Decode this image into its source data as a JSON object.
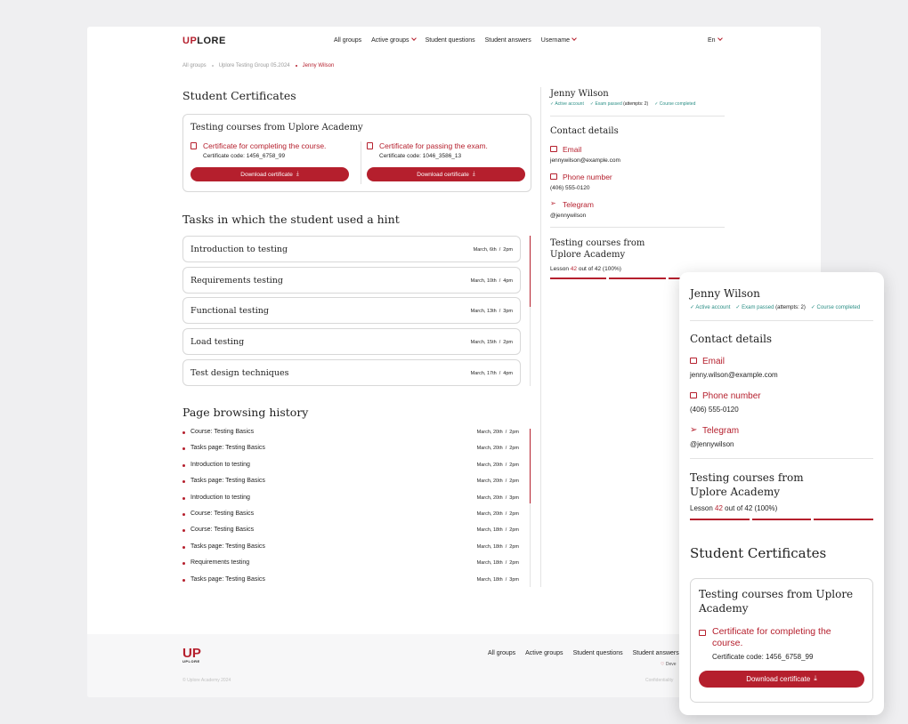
{
  "header": {
    "logo": "UPLORE",
    "nav": [
      "All groups",
      "Active groups",
      "Student questions",
      "Student answers",
      "Username"
    ],
    "lang": "En"
  },
  "breadcrumb": [
    "All groups",
    "Uplore Testing Group 05.2024",
    "Jenny Wilson"
  ],
  "certificates": {
    "title": "Student Certificates",
    "course": "Testing courses from Uplore Academy",
    "items": [
      {
        "label": "Certificate for completing the course.",
        "code": "Certificate code: 1456_6758_99",
        "button": "Download certificate"
      },
      {
        "label": "Certificate for passing the exam.",
        "code": "Certificate code: 1046_3586_13",
        "button": "Download certificate"
      }
    ]
  },
  "tasks": {
    "title": "Tasks in which the student used a hint",
    "items": [
      {
        "name": "Introduction to testing",
        "date": "March, 6th",
        "time": "2pm"
      },
      {
        "name": "Requirements testing",
        "date": "March, 10th",
        "time": "4pm"
      },
      {
        "name": "Functional testing",
        "date": "March, 13th",
        "time": "3pm"
      },
      {
        "name": "Load testing",
        "date": "March, 15th",
        "time": "2pm"
      },
      {
        "name": "Test design techniques",
        "date": "March, 17th",
        "time": "4pm"
      }
    ]
  },
  "history": {
    "title": "Page browsing history",
    "items": [
      {
        "name": "Course: Testing Basics",
        "date": "March, 20th",
        "time": "2pm"
      },
      {
        "name": "Tasks page: Testing Basics",
        "date": "March, 20th",
        "time": "2pm"
      },
      {
        "name": "Introduction to testing",
        "date": "March, 20th",
        "time": "2pm"
      },
      {
        "name": "Tasks page: Testing Basics",
        "date": "March, 20th",
        "time": "2pm"
      },
      {
        "name": "Introduction to testing",
        "date": "March, 20th",
        "time": "3pm"
      },
      {
        "name": "Course: Testing Basics",
        "date": "March, 20th",
        "time": "2pm"
      },
      {
        "name": "Course: Testing Basics",
        "date": "March, 18th",
        "time": "2pm"
      },
      {
        "name": "Tasks page: Testing Basics",
        "date": "March, 18th",
        "time": "2pm"
      },
      {
        "name": "Requirements testing",
        "date": "March, 18th",
        "time": "2pm"
      },
      {
        "name": "Tasks page: Testing Basics",
        "date": "March, 18th",
        "time": "3pm"
      }
    ]
  },
  "student": {
    "name": "Jenny Wilson",
    "badges": [
      "Active account",
      "Exam passed",
      "(attempts: 2)",
      "Course completed"
    ],
    "contact_title": "Contact details",
    "email_label": "Email",
    "email": "jennywilson@example.com",
    "mobile_email": "jenny.wilson@example.com",
    "phone_label": "Phone number",
    "phone": "(406) 555-0120",
    "telegram_label": "Telegram",
    "telegram": "@jennywilson",
    "course_title": "Testing courses from Uplore Academy",
    "course_title_l1": "Testing courses from",
    "course_title_l2": "Uplore Academy",
    "lesson_prefix": "Lesson",
    "lesson_current": "42",
    "lesson_suffix": "out of 42 (100%)",
    "progress": 1.0
  },
  "footer": {
    "logo": "UP",
    "logo_sub": "UPLORE",
    "nav": [
      "All groups",
      "Active groups",
      "Student questions",
      "Student answers"
    ],
    "copyright": "© Uplore Academy 2024",
    "dev": "Deve",
    "confidential": "Confidentiality"
  },
  "panel": {
    "cert_title": "Student Certificates",
    "course_l1": "Testing courses from Uplore",
    "course_l2": "Academy",
    "cert_label_l1": "Certificate for completing the",
    "cert_label_l2": "course.",
    "cert_code": "Certificate code: 1456_6758_99",
    "button": "Download certificate"
  },
  "colors": {
    "accent": "#b51f2d",
    "success": "#2c8f86",
    "border": "#d8d8d8"
  }
}
